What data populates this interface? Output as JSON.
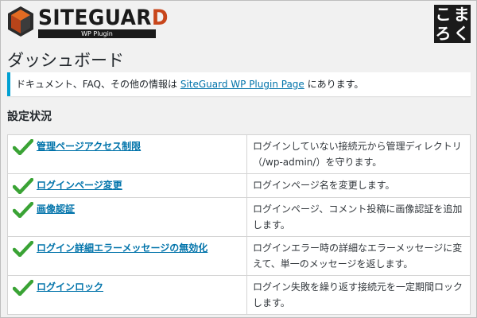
{
  "header": {
    "logo_main": "SITEGUAR",
    "logo_accent": "D",
    "logo_sub": "WP Plugin",
    "komaroku": [
      "こ",
      "ま",
      "ろ",
      "く"
    ]
  },
  "page": {
    "title": "ダッシュボード",
    "notice_before": "ドキュメント、FAQ、その他の情報は ",
    "notice_link": "SiteGuard WP Plugin Page",
    "notice_after": " にあります。",
    "section_title": "設定状況"
  },
  "features": [
    {
      "name": "管理ページアクセス制限",
      "desc": "ログインしていない接続元から管理ディレクトリ（/wp-admin/）を守ります。",
      "enabled": true
    },
    {
      "name": "ログインページ変更",
      "desc": "ログインページ名を変更します。",
      "enabled": true
    },
    {
      "name": "画像認証",
      "desc": "ログインページ、コメント投稿に画像認証を追加します。",
      "enabled": true
    },
    {
      "name": "ログイン詳細エラーメッセージの無効化",
      "desc": "ログインエラー時の詳細なエラーメッセージに変えて、単一のメッセージを返します。",
      "enabled": true
    },
    {
      "name": "ログインロック",
      "desc": "ログイン失敗を繰り返す接続元を一定期間ロックします。",
      "enabled": true
    }
  ],
  "colors": {
    "link": "#0073aa",
    "check": "#3aa335",
    "notice_border": "#00a0d2",
    "logo_accent": "#c8461b"
  },
  "icons": {
    "status": "check-icon",
    "logo": "siteguard-shield-icon"
  }
}
